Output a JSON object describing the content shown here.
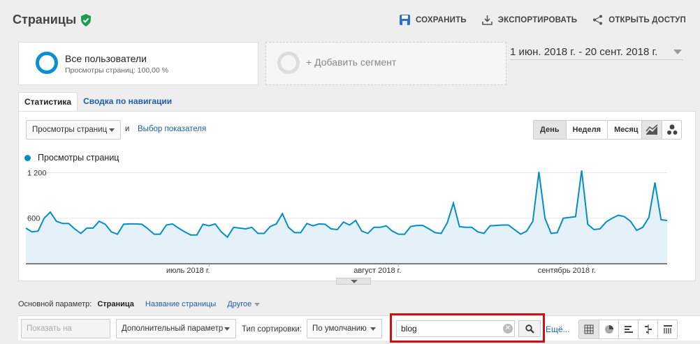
{
  "header": {
    "title": "Страницы",
    "actions": {
      "save": "СОХРАНИТЬ",
      "export": "ЭКСПОРТИРОВАТЬ",
      "share": "ОТКРЫТЬ ДОСТУП"
    }
  },
  "segments": {
    "active": {
      "name": "Все пользователи",
      "sub": "Просмотры страниц: 100,00 %"
    },
    "add_label": "+ Добавить сегмент"
  },
  "date_range": "1 июн. 2018 г. - 20 сент. 2018 г.",
  "tabs": [
    "Статистика",
    "Сводка по навигации"
  ],
  "chart_controls": {
    "metric": "Просмотры страниц",
    "and_label": "и",
    "choose_metric": "Выбор показателя",
    "periods": [
      "День",
      "Неделя",
      "Месяц"
    ],
    "icons": [
      "line-chart-icon",
      "motion-chart-icon"
    ]
  },
  "accent_color": "#058dc7",
  "chart_data": {
    "type": "area",
    "series": [
      {
        "name": "Просмотры страниц",
        "values": [
          470,
          420,
          430,
          600,
          680,
          560,
          530,
          530,
          460,
          400,
          470,
          470,
          560,
          520,
          420,
          390,
          520,
          525,
          525,
          520,
          460,
          390,
          390,
          510,
          525,
          470,
          420,
          380,
          380,
          520,
          500,
          525,
          420,
          350,
          480,
          470,
          460,
          480,
          400,
          400,
          490,
          525,
          660,
          480,
          410,
          410,
          530,
          500,
          525,
          520,
          460,
          450,
          550,
          510,
          570,
          430,
          400,
          480,
          480,
          500,
          430,
          390,
          390,
          490,
          505,
          505,
          460,
          410,
          400,
          540,
          800,
          490,
          480,
          480,
          420,
          400,
          500,
          505,
          510,
          510,
          450,
          390,
          430,
          560,
          1210,
          600,
          400,
          410,
          600,
          610,
          620,
          1230,
          520,
          450,
          460,
          550,
          600,
          640,
          620,
          560,
          440,
          480,
          610,
          1070,
          580,
          570
        ]
      }
    ],
    "x_tick_labels": [
      "июль 2018 г.",
      "август 2018 г.",
      "сентябрь 2018 г."
    ],
    "y_tick_labels": [
      "1 200",
      "600"
    ],
    "ylim": [
      0,
      1200
    ],
    "grid": true
  },
  "dimensions": {
    "label": "Основной параметр:",
    "current": "Страница",
    "alt": "Название страницы",
    "other": "Другое"
  },
  "toolbar": {
    "plot_rows": "Показать на диаграмме",
    "secondary": "Дополнительный параметр",
    "sort_label": "Тип сортировки:",
    "sort_value": "По умолчанию",
    "search_value": "blog",
    "more": "Ещё...",
    "views": [
      "table-view-icon",
      "pie-view-icon",
      "performance-view-icon",
      "comparison-view-icon",
      "pivot-view-icon"
    ]
  }
}
